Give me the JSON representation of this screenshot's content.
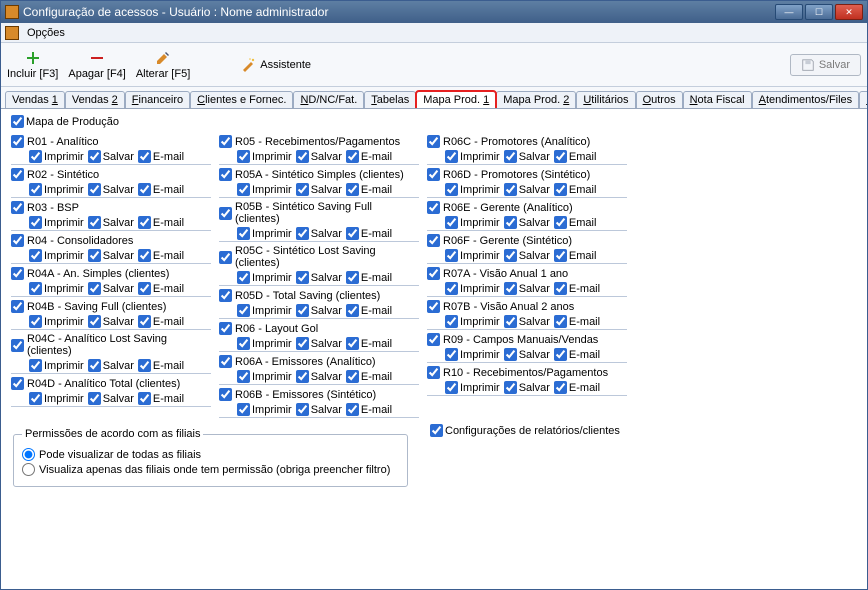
{
  "window": {
    "title": "Configuração de acessos - Usuário : Nome administrador"
  },
  "menubar": {
    "opcoes": "Opções"
  },
  "toolbar": {
    "incluir": "Incluir [F3]",
    "apagar": "Apagar [F4]",
    "alterar": "Alterar [F5]",
    "assistente": "Assistente",
    "salvar": "Salvar"
  },
  "tabs": {
    "items": [
      "Vendas 1",
      "Vendas 2",
      "Financeiro",
      "Clientes e Fornec.",
      "ND/NC/Fat.",
      "Tabelas",
      "Mapa Prod. 1",
      "Mapa Prod. 2",
      "Utilitários",
      "Outros",
      "Nota Fiscal",
      "Atendimentos/Files",
      "Reemb."
    ],
    "active_index": 6,
    "highlight_index": 6
  },
  "main_checkbox_label": "Mapa de Produção",
  "sub_labels": {
    "imprimir": "Imprimir",
    "salvar": "Salvar",
    "email": "E-mail",
    "email_alt": "Email"
  },
  "columns": [
    [
      {
        "label": "R01 - Analítico",
        "subs": [
          "Imprimir",
          "Salvar",
          "E-mail"
        ]
      },
      {
        "label": "R02 - Sintético",
        "subs": [
          "Imprimir",
          "Salvar",
          "E-mail"
        ]
      },
      {
        "label": "R03 - BSP",
        "subs": [
          "Imprimir",
          "Salvar",
          "E-mail"
        ]
      },
      {
        "label": "R04 - Consolidadores",
        "subs": [
          "Imprimir",
          "Salvar",
          "E-mail"
        ]
      },
      {
        "label": "R04A - An. Simples (clientes)",
        "subs": [
          "Imprimir",
          "Salvar",
          "E-mail"
        ]
      },
      {
        "label": "R04B - Saving Full (clientes)",
        "subs": [
          "Imprimir",
          "Salvar",
          "E-mail"
        ]
      },
      {
        "label": "R04C - Analítico Lost Saving (clientes)",
        "subs": [
          "Imprimir",
          "Salvar",
          "E-mail"
        ]
      },
      {
        "label": "R04D - Analítico Total (clientes)",
        "subs": [
          "Imprimir",
          "Salvar",
          "E-mail"
        ]
      }
    ],
    [
      {
        "label": "R05 - Recebimentos/Pagamentos",
        "subs": [
          "Imprimir",
          "Salvar",
          "E-mail"
        ]
      },
      {
        "label": "R05A - Sintético Simples (clientes)",
        "subs": [
          "Imprimir",
          "Salvar",
          "E-mail"
        ]
      },
      {
        "label": "R05B - Sintético Saving Full (clientes)",
        "subs": [
          "Imprimir",
          "Salvar",
          "E-mail"
        ]
      },
      {
        "label": "R05C - Sintético Lost Saving (clientes)",
        "subs": [
          "Imprimir",
          "Salvar",
          "E-mail"
        ]
      },
      {
        "label": "R05D - Total Saving (clientes)",
        "subs": [
          "Imprimir",
          "Salvar",
          "E-mail"
        ]
      },
      {
        "label": "R06 - Layout Gol",
        "subs": [
          "Imprimir",
          "Salvar",
          "E-mail"
        ]
      },
      {
        "label": "R06A - Emissores (Analítico)",
        "subs": [
          "Imprimir",
          "Salvar",
          "E-mail"
        ]
      },
      {
        "label": "R06B - Emissores (Sintético)",
        "subs": [
          "Imprimir",
          "Salvar",
          "E-mail"
        ]
      }
    ],
    [
      {
        "label": "R06C - Promotores (Analítico)",
        "subs": [
          "Imprimir",
          "Salvar",
          "Email"
        ]
      },
      {
        "label": "R06D - Promotores (Sintético)",
        "subs": [
          "Imprimir",
          "Salvar",
          "Email"
        ]
      },
      {
        "label": "R06E - Gerente (Analítico)",
        "subs": [
          "Imprimir",
          "Salvar",
          "Email"
        ]
      },
      {
        "label": "R06F - Gerente (Sintético)",
        "subs": [
          "Imprimir",
          "Salvar",
          "Email"
        ]
      },
      {
        "label": "R07A - Visão Anual 1 ano",
        "subs": [
          "Imprimir",
          "Salvar",
          "E-mail"
        ]
      },
      {
        "label": "R07B - Visão Anual 2 anos",
        "subs": [
          "Imprimir",
          "Salvar",
          "E-mail"
        ]
      },
      {
        "label": "R09 - Campos Manuais/Vendas",
        "subs": [
          "Imprimir",
          "Salvar",
          "E-mail"
        ]
      },
      {
        "label": "R10 - Recebimentos/Pagamentos",
        "subs": [
          "Imprimir",
          "Salvar",
          "E-mail"
        ]
      }
    ]
  ],
  "fieldset": {
    "legend": "Permissões de acordo com as filiais",
    "opt1": "Pode visualizar de todas as filiais",
    "opt2": "Visualiza apenas das filiais onde tem permissão (obriga preencher filtro)",
    "selected": 0
  },
  "config_check_label": "Configurações de relatórios/clientes"
}
